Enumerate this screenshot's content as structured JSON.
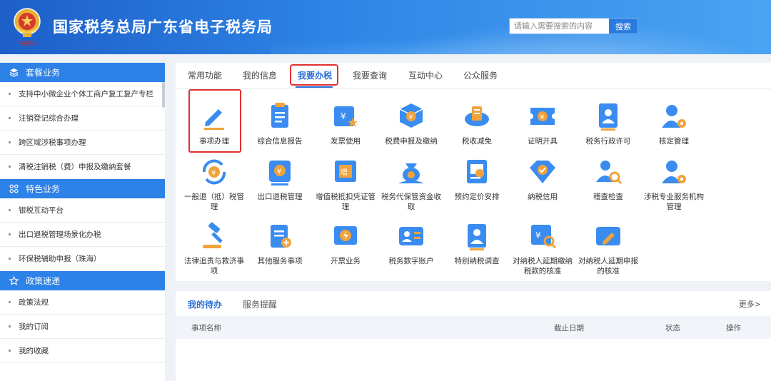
{
  "header": {
    "logo_text": "中国税务",
    "site_title": "国家税务总局广东省电子税务局",
    "search_placeholder": "请输入需要搜索的内容",
    "search_button": "搜索"
  },
  "sidebar": {
    "sections": [
      {
        "title": "套餐业务",
        "icon": "layers-icon",
        "items": [
          "支持中小微企业个体工商户复工复产专栏",
          "注销登记综合办理",
          "跨区域涉税事项办理",
          "清税注销税（费）申报及缴纳套餐"
        ]
      },
      {
        "title": "特色业务",
        "icon": "grid-icon",
        "items": [
          "银税互动平台",
          "出口退税管理场景化办税",
          "环保税辅助申报（珠海）"
        ]
      },
      {
        "title": "政策速递",
        "icon": "star-icon",
        "items": [
          "政策法规",
          "我的订阅",
          "我的收藏"
        ]
      }
    ]
  },
  "main": {
    "tabs": [
      "常用功能",
      "我的信息",
      "我要办税",
      "我要查询",
      "互动中心",
      "公众服务"
    ],
    "active_tab": "我要办税",
    "tiles": [
      {
        "label": "事项办理",
        "icon": "pencil-icon"
      },
      {
        "label": "综合信息报告",
        "icon": "report-icon"
      },
      {
        "label": "发票使用",
        "icon": "invoice-icon"
      },
      {
        "label": "税费申报及缴纳",
        "icon": "tax-cube-icon"
      },
      {
        "label": "税收减免",
        "icon": "coins-icon"
      },
      {
        "label": "证明开具",
        "icon": "ticket-icon"
      },
      {
        "label": "税务行政许可",
        "icon": "license-icon"
      },
      {
        "label": "核定管理",
        "icon": "user-gear-icon"
      },
      {
        "label": "一般退（抵）税管理",
        "icon": "refund-icon"
      },
      {
        "label": "出口退税管理",
        "icon": "export-refund-icon"
      },
      {
        "label": "增值税抵扣凭证管理",
        "icon": "vat-voucher-icon"
      },
      {
        "label": "税务代保管资金收取",
        "icon": "money-bag-icon"
      },
      {
        "label": "预约定价安排",
        "icon": "pricing-doc-icon"
      },
      {
        "label": "纳税信用",
        "icon": "diamond-check-icon"
      },
      {
        "label": "稽查检查",
        "icon": "inspect-icon"
      },
      {
        "label": "涉税专业服务机构管理",
        "icon": "agency-gear-icon"
      },
      {
        "label": "法律追责与救济事项",
        "icon": "gavel-icon"
      },
      {
        "label": "其他服务事项",
        "icon": "clipboard-icon"
      },
      {
        "label": "开票业务",
        "icon": "flash-card-icon"
      },
      {
        "label": "税务数字账户",
        "icon": "account-card-icon"
      },
      {
        "label": "特别纳税调查",
        "icon": "investigate-icon"
      },
      {
        "label": "对纳税人延期缴纳税款的核准",
        "icon": "deferred-pay-icon"
      },
      {
        "label": "对纳税人延期申报的核准",
        "icon": "deferred-report-icon"
      }
    ]
  },
  "todo": {
    "tabs": [
      "我的待办",
      "服务提醒"
    ],
    "active_tab": "我的待办",
    "more": "更多>",
    "columns": [
      "事项名称",
      "截止日期",
      "状态",
      "操作"
    ]
  }
}
